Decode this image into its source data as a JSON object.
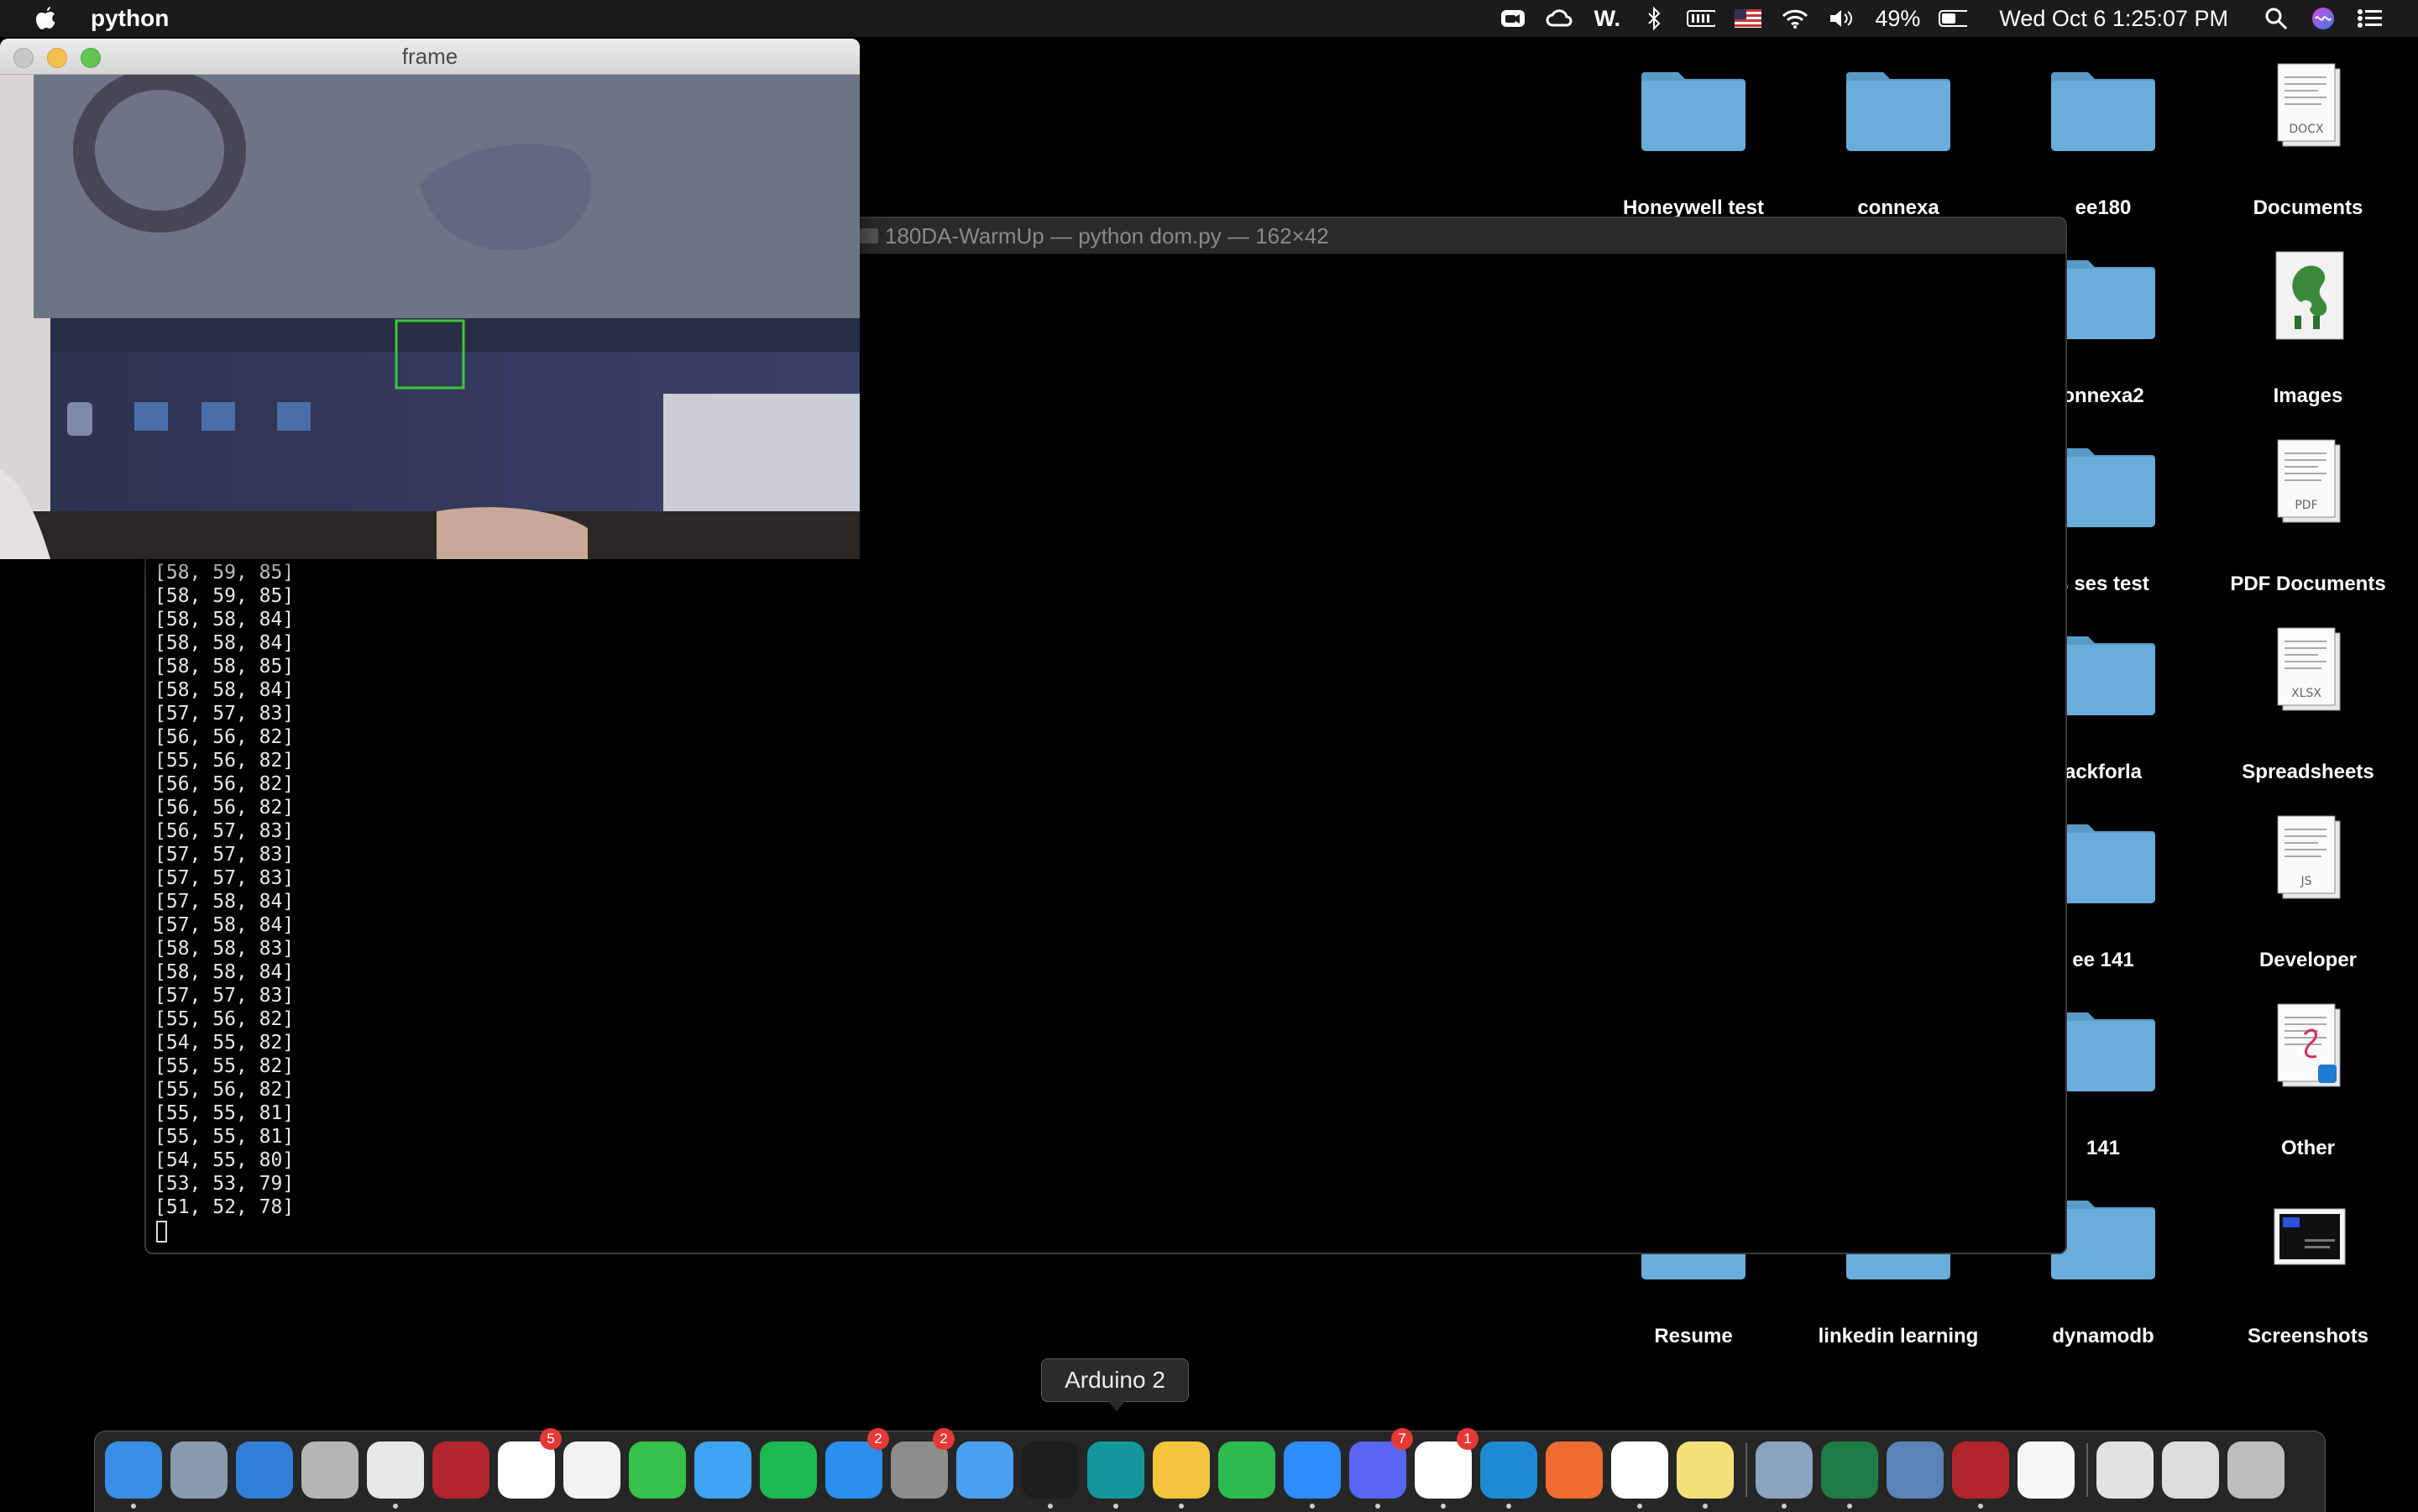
{
  "menubar": {
    "app_name": "python",
    "battery_percent": "49%",
    "datetime": "Wed Oct 6  1:25:07 PM",
    "status_icons": [
      "zoom-icon",
      "creative-cloud-icon",
      "w-icon",
      "bluetooth-icon",
      "battery-level-icon",
      "us-flag-icon",
      "wifi-icon",
      "volume-icon",
      "battery-icon",
      "spotlight-search-icon",
      "siri-icon",
      "control-center-icon"
    ]
  },
  "desktop": {
    "items": [
      {
        "label": "Honeywell test",
        "kind": "folder"
      },
      {
        "label": "connexa",
        "kind": "folder"
      },
      {
        "label": "ee180",
        "kind": "folder"
      },
      {
        "label": "Documents",
        "kind": "doc",
        "tag": "DOCX"
      },
      {
        "label": "onnexa2",
        "kind": "folder"
      },
      {
        "label": "Images",
        "kind": "image"
      },
      {
        "label": "s ses test",
        "kind": "folder"
      },
      {
        "label": "PDF Documents",
        "kind": "doc",
        "tag": "PDF"
      },
      {
        "label": "ackforla",
        "kind": "folder"
      },
      {
        "label": "Spreadsheets",
        "kind": "doc",
        "tag": "XLSX"
      },
      {
        "label": "ee 141",
        "kind": "folder"
      },
      {
        "label": "Developer",
        "kind": "doc",
        "tag": "JS"
      },
      {
        "label": "141",
        "kind": "folder"
      },
      {
        "label": "Other",
        "kind": "doc",
        "tag": ""
      },
      {
        "label": "Resume",
        "kind": "folder"
      },
      {
        "label": "linkedin learning",
        "kind": "folder"
      },
      {
        "label": "dynamodb",
        "kind": "folder"
      },
      {
        "label": "Screenshots",
        "kind": "screenshot"
      }
    ]
  },
  "terminal": {
    "title": "180DA-WarmUp — python dom.py — 162×42",
    "lines": [
      "[58, 59, 85]",
      "[58, 59, 85]",
      "[58, 58, 84]",
      "[58, 58, 84]",
      "[58, 58, 85]",
      "[58, 58, 84]",
      "[57, 57, 83]",
      "[56, 56, 82]",
      "[55, 56, 82]",
      "[56, 56, 82]",
      "[56, 56, 82]",
      "[56, 57, 83]",
      "[57, 57, 83]",
      "[57, 57, 83]",
      "[57, 58, 84]",
      "[57, 58, 84]",
      "[58, 58, 83]",
      "[58, 58, 84]",
      "[57, 57, 83]",
      "[55, 56, 82]",
      "[54, 55, 82]",
      "[55, 55, 82]",
      "[55, 56, 82]",
      "[55, 55, 81]",
      "[55, 55, 81]",
      "[54, 55, 80]",
      "[53, 53, 79]",
      "[51, 52, 78]"
    ]
  },
  "frame_window": {
    "title": "frame"
  },
  "tooltip": {
    "text": "Arduino 2"
  },
  "dock": {
    "apps": [
      {
        "name": "finder-icon",
        "color": "#3a8ee6",
        "badge": null,
        "running": true
      },
      {
        "name": "launchpad-icon",
        "color": "#8a9bb0",
        "badge": null,
        "running": false
      },
      {
        "name": "safari-icon",
        "color": "#2f7fd6",
        "badge": null,
        "running": false
      },
      {
        "name": "calculator-icon",
        "color": "#b5b5b5",
        "badge": null,
        "running": false
      },
      {
        "name": "chrome-icon",
        "color": "#e8e8e8",
        "badge": null,
        "running": true
      },
      {
        "name": "photo-booth-icon",
        "color": "#b3262d",
        "badge": null,
        "running": false
      },
      {
        "name": "calendar-icon",
        "color": "#ffffff",
        "badge": "5",
        "running": false
      },
      {
        "name": "photos-icon",
        "color": "#f2f2f2",
        "badge": null,
        "running": false
      },
      {
        "name": "facetime-icon",
        "color": "#36c14a",
        "badge": null,
        "running": false
      },
      {
        "name": "messages-icon",
        "color": "#3da3f5",
        "badge": null,
        "running": false
      },
      {
        "name": "spotify-icon",
        "color": "#1db954",
        "badge": null,
        "running": false
      },
      {
        "name": "app-store-icon",
        "color": "#2a8ff0",
        "badge": "2",
        "running": false
      },
      {
        "name": "system-preferences-icon",
        "color": "#8d8d8d",
        "badge": "2",
        "running": false
      },
      {
        "name": "xcode-icon",
        "color": "#4aa0f0",
        "badge": null,
        "running": false
      },
      {
        "name": "terminal-icon",
        "color": "#1e1e1e",
        "badge": null,
        "running": true
      },
      {
        "name": "arduino-icon",
        "color": "#14979c",
        "badge": null,
        "running": true
      },
      {
        "name": "cyberduck-icon",
        "color": "#f2c53d",
        "badge": null,
        "running": true
      },
      {
        "name": "whatsapp-icon",
        "color": "#2bbb4f",
        "badge": null,
        "running": false
      },
      {
        "name": "zoom-icon",
        "color": "#2d8cff",
        "badge": null,
        "running": true
      },
      {
        "name": "discord-icon",
        "color": "#5865f2",
        "badge": "7",
        "running": true
      },
      {
        "name": "slack-icon",
        "color": "#ffffff",
        "badge": "1",
        "running": true
      },
      {
        "name": "vscode-icon",
        "color": "#1f8ad2",
        "badge": null,
        "running": true
      },
      {
        "name": "postman-icon",
        "color": "#f06b2f",
        "badge": null,
        "running": false
      },
      {
        "name": "notion-icon",
        "color": "#ffffff",
        "badge": null,
        "running": true
      },
      {
        "name": "stickies-icon",
        "color": "#f3e07a",
        "badge": null,
        "running": true
      },
      {
        "name": "preview-icon",
        "color": "#8aa3bf",
        "badge": null,
        "running": true
      },
      {
        "name": "excel-icon",
        "color": "#1e7b45",
        "badge": null,
        "running": true
      },
      {
        "name": "mail-bird-icon",
        "color": "#5c83b8",
        "badge": null,
        "running": false
      },
      {
        "name": "dictionary-icon",
        "color": "#b0262b",
        "badge": null,
        "running": true
      },
      {
        "name": "document-icon",
        "color": "#f7f7f7",
        "badge": null,
        "running": false
      },
      {
        "name": "documents-stack-icon",
        "color": "#e2e2e2",
        "badge": null,
        "running": false
      },
      {
        "name": "screenshot-stack-icon",
        "color": "#dcdcdc",
        "badge": null,
        "running": false
      },
      {
        "name": "trash-icon",
        "color": "#bdbdbd",
        "badge": null,
        "running": false
      }
    ]
  }
}
